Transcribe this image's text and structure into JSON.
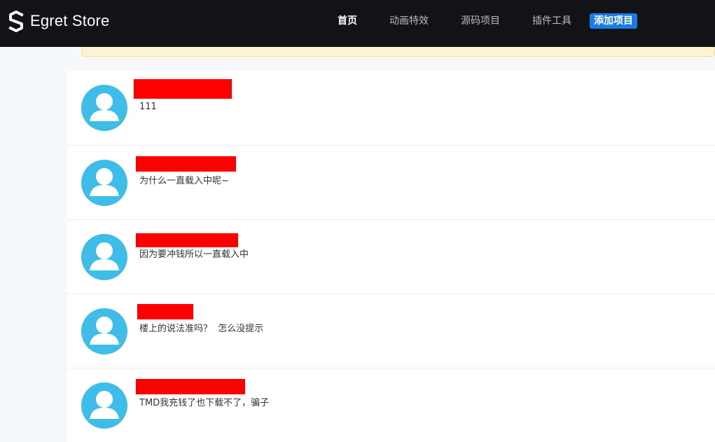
{
  "brand": {
    "name": "Egret Store",
    "logo_icon": "egret-s-logo-icon"
  },
  "nav": {
    "items": [
      {
        "label": "首页",
        "active": true
      },
      {
        "label": "动画特效",
        "active": false
      },
      {
        "label": "源码项目",
        "active": false
      },
      {
        "label": "插件工具",
        "active": false
      }
    ],
    "add_button": "添加项目"
  },
  "colors": {
    "topbar": "#121316",
    "accent": "#1a7be8",
    "avatar": "#3fbde9",
    "redaction": "#ff0000",
    "notice": "#fbf3d2"
  },
  "comments": [
    {
      "text": "111",
      "avatar_icon": "user-avatar-icon"
    },
    {
      "text": "为什么一直载入中呢~",
      "avatar_icon": "user-avatar-icon"
    },
    {
      "text": "因为要冲钱所以一直载入中",
      "avatar_icon": "user-avatar-icon"
    },
    {
      "text": "楼上的说法准吗？  怎么没提示",
      "avatar_icon": "user-avatar-icon"
    },
    {
      "text": "TMD我充钱了也下载不了，骗子",
      "avatar_icon": "user-avatar-icon"
    }
  ]
}
